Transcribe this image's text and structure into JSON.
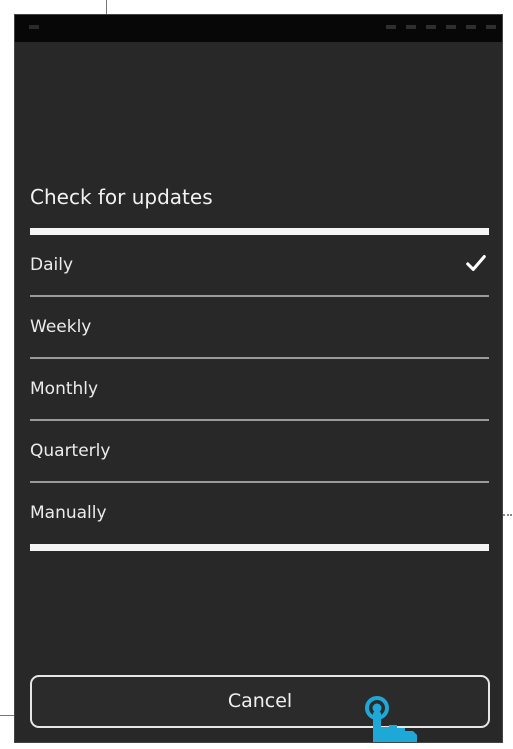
{
  "dialog": {
    "title": "Check for updates",
    "options": [
      {
        "label": "Daily",
        "selected": true
      },
      {
        "label": "Weekly",
        "selected": false
      },
      {
        "label": "Monthly",
        "selected": false
      },
      {
        "label": "Quarterly",
        "selected": false
      },
      {
        "label": "Manually",
        "selected": false
      }
    ],
    "cancel_label": "Cancel"
  },
  "icons": {
    "selected": "check-icon",
    "gesture": "touch-hand-icon"
  },
  "colors": {
    "background": "#282828",
    "statusbar": "#070707",
    "text": "#ececec",
    "accent_touch": "#1ea8d8"
  }
}
